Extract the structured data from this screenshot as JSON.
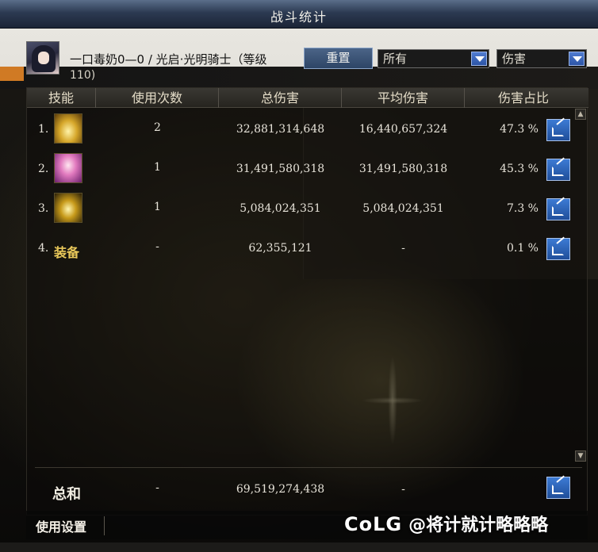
{
  "window": {
    "title": "战斗统计"
  },
  "character": {
    "name": "一口毒奶0—0 / 光启·光明骑士（等级",
    "level": "110)"
  },
  "toolbar": {
    "reset_label": "重置",
    "filter_selected": "所有",
    "metric_selected": "伤害"
  },
  "table": {
    "headers": {
      "skill": "技能",
      "count": "使用次数",
      "total": "总伤害",
      "avg": "平均伤害",
      "pct": "伤害占比"
    },
    "rows": [
      {
        "index": "1.",
        "icon": "golden-pillar-skill-icon",
        "count": "2",
        "total": "32,881,314,648",
        "avg": "16,440,657,324",
        "pct": "47.3 %"
      },
      {
        "index": "2.",
        "icon": "pink-angel-skill-icon",
        "count": "1",
        "total": "31,491,580,318",
        "avg": "31,491,580,318",
        "pct": "45.3 %"
      },
      {
        "index": "3.",
        "icon": "lightning-burst-skill-icon",
        "count": "1",
        "total": "5,084,024,351",
        "avg": "5,084,024,351",
        "pct": "7.3 %"
      },
      {
        "index": "4.",
        "label": "装备",
        "count": "-",
        "total": "62,355,121",
        "avg": "-",
        "pct": "0.1 %"
      }
    ],
    "total": {
      "label": "总和",
      "count": "-",
      "total": "69,519,274,438",
      "avg": "-"
    }
  },
  "footer": {
    "settings_label": "使用设置",
    "watermark_logo": "CoLG",
    "watermark_text": "@将计就计略略略"
  },
  "colors": {
    "title_bar": "#2c3a52",
    "button_blue": "#2d4566",
    "share_blue": "#3d7bd4",
    "equip_gold": "#e9c85a"
  }
}
